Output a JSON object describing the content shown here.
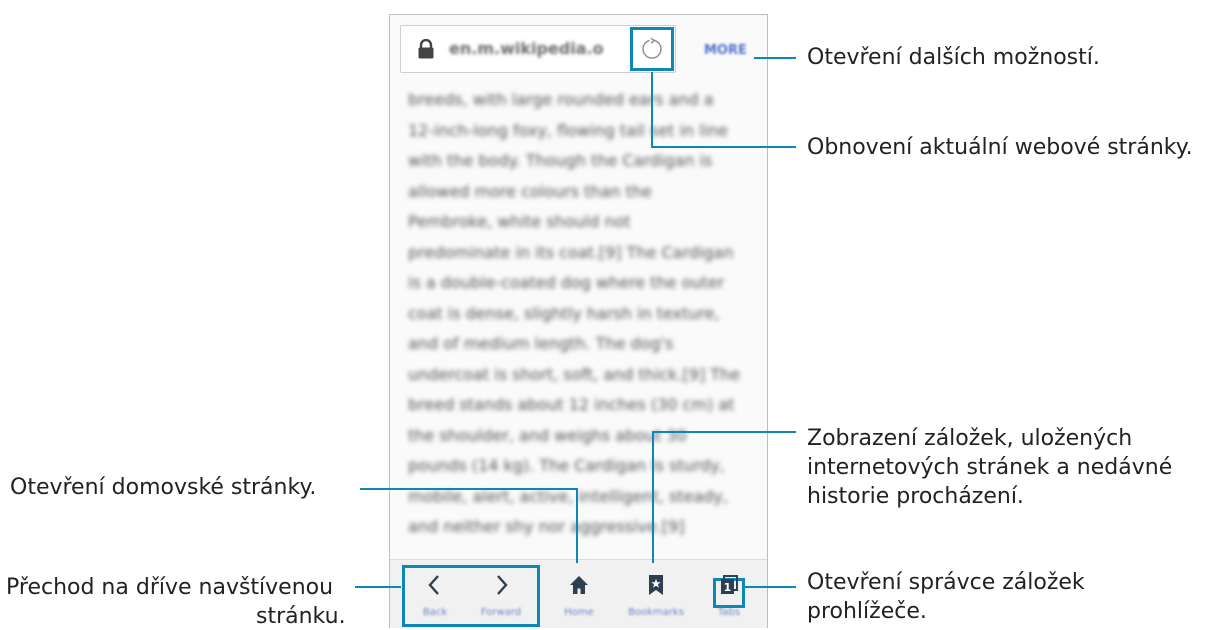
{
  "browser": {
    "url": "en.m.wikipedia.o",
    "more_label": "MORE",
    "article_lines": [
      "breeds, with large rounded ears and a",
      "12-inch-long foxy, flowing tail set in line",
      "with the body. Though the Cardigan is",
      "allowed more colours than the",
      "Pembroke, white should not",
      "predominate in its coat.[9] The Cardigan",
      "is a double-coated dog where the outer",
      "coat is dense, slightly harsh in texture,",
      "and of medium length. The dog's",
      "undercoat is short, soft, and thick.[9] The",
      "breed stands about 12 inches (30 cm) at",
      "the shoulder, and weighs about 30",
      "pounds (14 kg). The Cardigan is sturdy,",
      "mobile, alert, active, intelligent, steady,",
      "and neither shy nor aggressive.[9]"
    ],
    "bottom_bar": {
      "back": "Back",
      "forward": "Forward",
      "home": "Home",
      "bookmarks": "Bookmarks",
      "tabs": "Tabs",
      "tabs_count": "1"
    }
  },
  "callouts": {
    "more": "Otevření dalších možností.",
    "reload": "Obnovení aktuální webové stránky.",
    "bookmarks_line1": "Zobrazení záložek, uložených",
    "bookmarks_line2": "internetových stránek a nedávné",
    "bookmarks_line3": "historie procházení.",
    "home": "Otevření domovské stránky.",
    "back_line1": "Přechod na dříve navštívenou",
    "back_line2": "stránku.",
    "tabs_line1": "Otevření správce záložek",
    "tabs_line2": "prohlížeče."
  },
  "colors": {
    "accent": "#0e86b6",
    "icon": "#2e3f52"
  }
}
